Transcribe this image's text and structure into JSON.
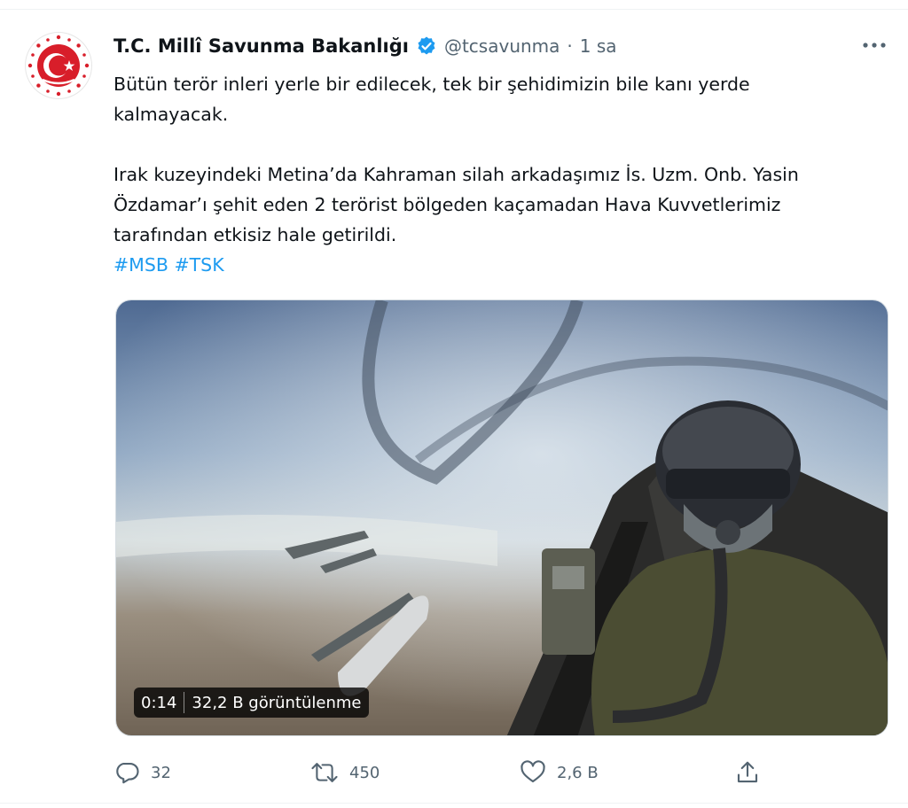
{
  "account": {
    "name": "T.C. Millî Savunma Bakanlığı",
    "handle": "@tcsavunma",
    "separator": "·",
    "time": "1 sa",
    "verified": true
  },
  "tweet": {
    "paragraph1_line1": "Bütün terör inleri yerle bir edilecek, tek bir şehidimizin bile kanı yerde",
    "paragraph1_line2": "kalmayacak.",
    "paragraph2_line1": "Irak kuzeyindeki Metina’da Kahraman silah arkadaşımız İs. Uzm. Onb. Yasin",
    "paragraph2_line2": "Özdamar’ı şehit eden 2 terörist bölgeden kaçamadan Hava Kuvvetlerimiz",
    "paragraph2_line3": "tarafından etkisiz hale getirildi.",
    "hashtags": [
      "#MSB",
      "#TSK"
    ]
  },
  "video": {
    "duration": "0:14",
    "views": "32,2 B görüntülenme"
  },
  "actions": {
    "replies": "32",
    "retweets": "450",
    "likes": "2,6 B"
  },
  "icons": {
    "avatar": "turkish-crest-icon",
    "verified": "verified-badge-icon",
    "more": "more-options-icon",
    "reply": "reply-icon",
    "retweet": "retweet-icon",
    "like": "heart-icon",
    "share": "share-icon"
  },
  "colors": {
    "accent": "#1d9bf0",
    "text": "#0f1419",
    "muted": "#536471",
    "crest": "#d81e2a"
  }
}
